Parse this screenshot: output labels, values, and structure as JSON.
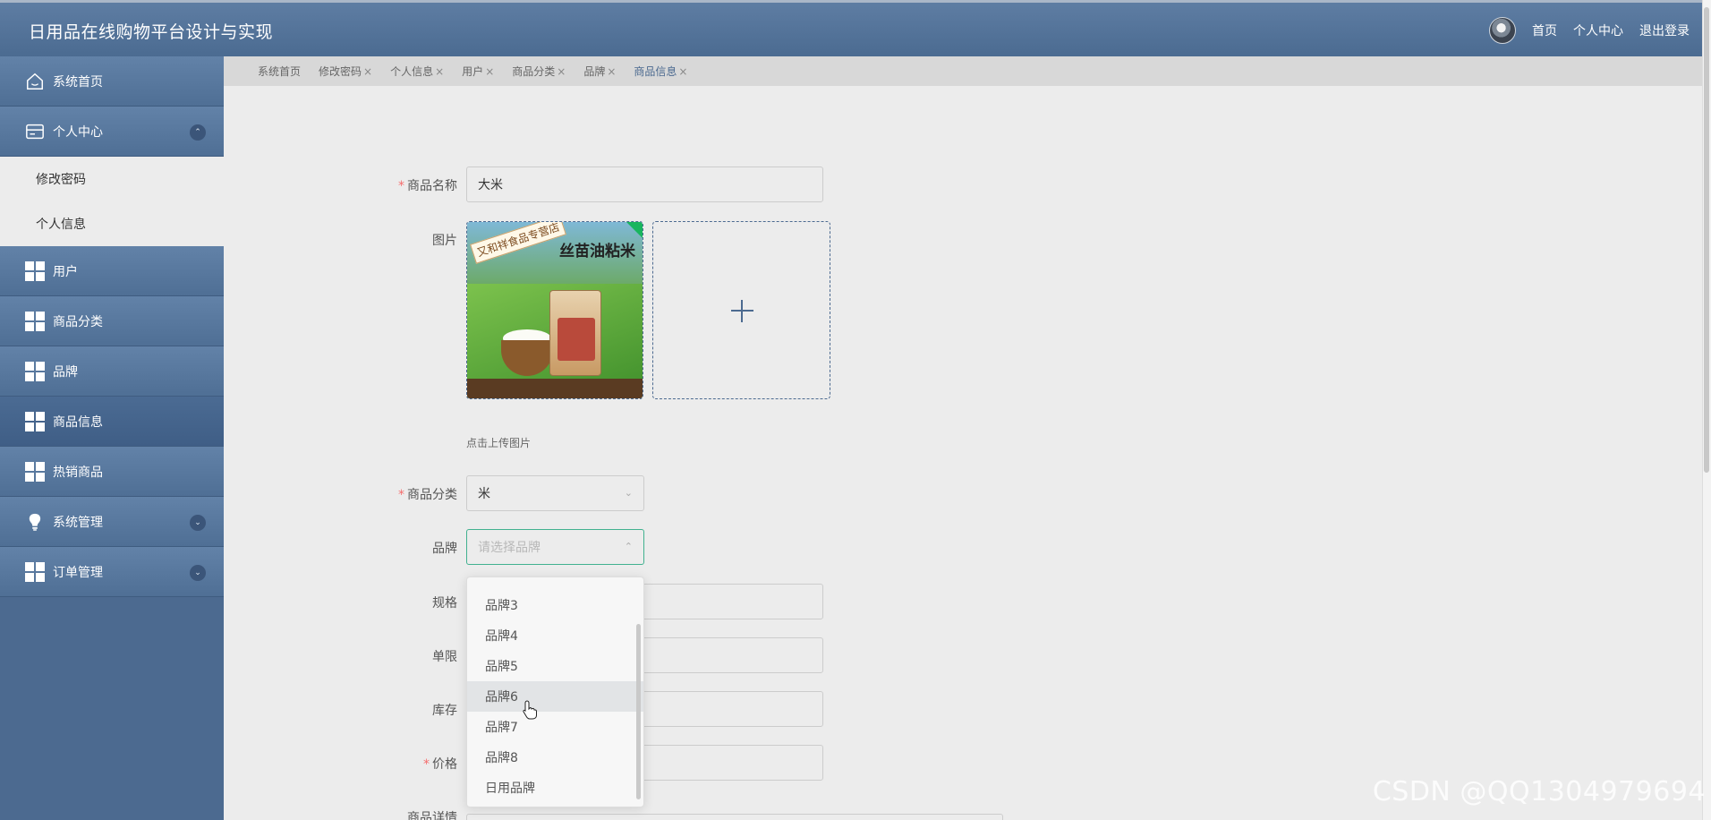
{
  "header": {
    "app_title": "日用品在线购物平台设计与实现",
    "links": [
      "首页",
      "个人中心",
      "退出登录"
    ]
  },
  "sidebar": {
    "home": "系统首页",
    "personal_center": "个人中心",
    "personal_sub": [
      "修改密码",
      "个人信息"
    ],
    "users": "用户",
    "categories": "商品分类",
    "brands": "品牌",
    "products": "商品信息",
    "hot": "热销商品",
    "system": "系统管理",
    "orders": "订单管理"
  },
  "tabs": [
    {
      "label": "系统首页",
      "closable": false
    },
    {
      "label": "修改密码",
      "closable": true
    },
    {
      "label": "个人信息",
      "closable": true
    },
    {
      "label": "用户",
      "closable": true
    },
    {
      "label": "商品分类",
      "closable": true
    },
    {
      "label": "品牌",
      "closable": true
    },
    {
      "label": "商品信息",
      "closable": true
    }
  ],
  "tab_close_glyph": "×",
  "form": {
    "name_label": "商品名称",
    "name_value": "大米",
    "image_label": "图片",
    "image_banner": "又和祥食品专营店",
    "image_title": "丝苗油粘米",
    "upload_hint": "点击上传图片",
    "category_label": "商品分类",
    "category_value": "米",
    "brand_label": "品牌",
    "brand_placeholder": "请选择品牌",
    "spec_label": "规格",
    "limit_label": "单限",
    "stock_label": "库存",
    "price_label": "价格",
    "detail_label": "商品详情",
    "required_mark": "*"
  },
  "brand_options": [
    "品牌3",
    "品牌4",
    "品牌5",
    "品牌6",
    "品牌7",
    "品牌8",
    "日用品牌"
  ],
  "hovered_option": "品牌6",
  "watermark": "CSDN @QQ1304979694",
  "colors": {
    "primary": "#4c6a90",
    "focus": "#41b18f",
    "required": "#f56c6c"
  }
}
